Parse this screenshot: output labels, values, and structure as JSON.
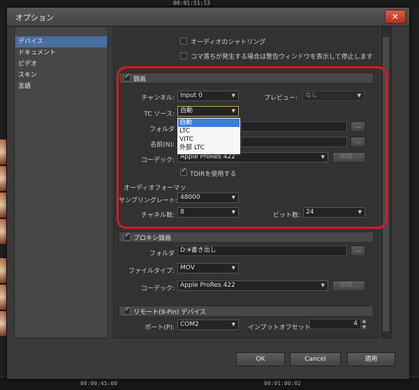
{
  "background": {
    "timecode_top": "00:01:51:13",
    "timecode_bottom_left": "00:00:45:00",
    "timecode_bottom_right": "00:01:00:02"
  },
  "dialog": {
    "title": "オプション",
    "close_label": "✕"
  },
  "nav": {
    "items": [
      "デバイス",
      "ドキュメント",
      "ビデオ",
      "スキン",
      "言語"
    ],
    "selected": 0
  },
  "audio": {
    "scrubbing_label": "オーディオのシャトリング",
    "drop_warning_label": "コマ落ちが発生する場合は警告ウィンドウを表示して停止します"
  },
  "record": {
    "header": "録画",
    "channel_label": "チャンネル:",
    "channel_value": "Input 0",
    "preview_label": "プレビュー:",
    "preview_value": "なし",
    "tc_source_label": "TC ソース:",
    "tc_source_value": "自動",
    "tc_options": [
      "自動",
      "LTC",
      "VITC",
      "外部 LTC"
    ],
    "folder_label": "フォルダ",
    "name_label": "名前(N):",
    "codec_label": "コーデック:",
    "codec_value": "Apple ProRes 422",
    "browse_label": "...",
    "details_label": "詳細...",
    "tdir_label": "TDIRを使用する",
    "audio_format_label": "オーディオフォーマッ",
    "sample_rate_label": "サンプリングレート:",
    "sample_rate_value": "48000",
    "channels_label": "チャネル数:",
    "channels_value": "8",
    "bits_label": "ビット数:",
    "bits_value": "24"
  },
  "proxy": {
    "header": "プロキシ録画",
    "folder_label": "フォルダ",
    "folder_value": "D:¥書き出し",
    "filetype_label": "ファイルタイプ:",
    "filetype_value": "MOV",
    "codec_label": "コーデック:",
    "codec_value": "Apple ProRes 422",
    "browse_label": "...",
    "details_label": "詳細..."
  },
  "remote": {
    "header": "リモート(9-Pin) デバイス",
    "port_label": "ポート(P):",
    "port_value": "COM2",
    "input_offset_label": "インプットオフセット:",
    "input_offset_value": "4"
  },
  "buttons": {
    "ok": "OK",
    "cancel": "Cancel",
    "apply": "適用"
  }
}
